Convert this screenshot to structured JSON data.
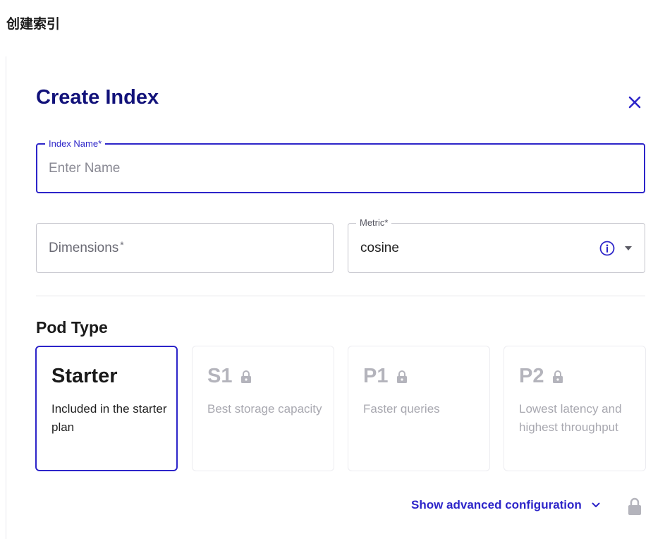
{
  "page": {
    "heading": "创建索引"
  },
  "modal": {
    "title": "Create Index",
    "close_icon": "close-icon"
  },
  "form": {
    "index_name": {
      "label": "Index Name",
      "required_mark": "*",
      "placeholder": "Enter Name",
      "value": ""
    },
    "dimensions": {
      "label": "Dimensions",
      "required_mark": "*",
      "value": ""
    },
    "metric": {
      "label": "Metric",
      "required_mark": "*",
      "value": "cosine",
      "info_icon": "info-icon",
      "dropdown_icon": "caret-down-icon"
    }
  },
  "pod_type": {
    "title": "Pod Type",
    "options": [
      {
        "name": "Starter",
        "description": "Included in the starter plan",
        "selected": true,
        "locked": false
      },
      {
        "name": "S1",
        "description": "Best storage capacity",
        "selected": false,
        "locked": true
      },
      {
        "name": "P1",
        "description": "Faster queries",
        "selected": false,
        "locked": true
      },
      {
        "name": "P2",
        "description": "Lowest latency and highest throughput",
        "selected": false,
        "locked": true
      }
    ]
  },
  "advanced": {
    "label": "Show advanced configuration",
    "chevron_icon": "chevron-down-icon",
    "lock_icon": "lock-icon"
  },
  "colors": {
    "accent": "#2d25c9",
    "title": "#12127a",
    "locked_text": "#b4b4bc",
    "border": "#c4c4cc"
  }
}
